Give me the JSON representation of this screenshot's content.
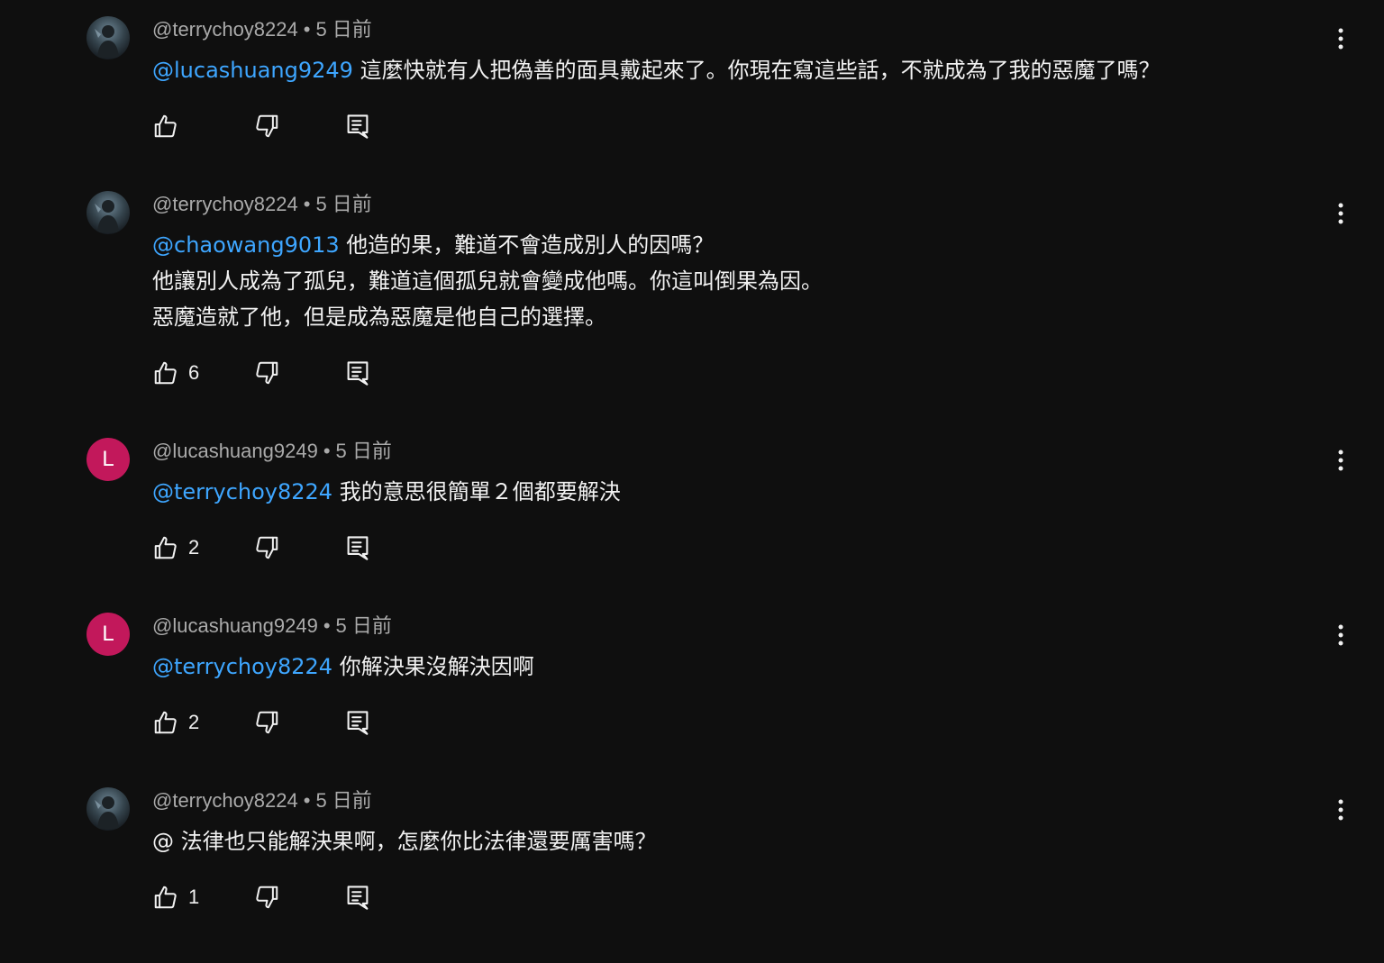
{
  "colors": {
    "background": "#0f0f0f",
    "text": "#f1f1f1",
    "meta_text": "#aaaaaa",
    "mention": "#3ea6ff",
    "letter_avatar": "#c2185b"
  },
  "comments": [
    {
      "author": "@terrychoy8224",
      "separator": "•",
      "time": "5 日前",
      "avatar": {
        "type": "photo",
        "icon": "user-photo-icon"
      },
      "mention": "@lucashuang9249",
      "text_lines": [
        "這麼快就有人把偽善的面具戴起來了。你現在寫這些話，不就成為了我的惡魔了嗎？"
      ],
      "likes": ""
    },
    {
      "author": "@terrychoy8224",
      "separator": "•",
      "time": "5 日前",
      "avatar": {
        "type": "photo",
        "icon": "user-photo-icon"
      },
      "mention": "@chaowang9013",
      "text_lines": [
        "他造的果，難道不會造成別人的因嗎？",
        "他讓別人成為了孤兒，難道這個孤兒就會變成他嗎。你這叫倒果為因。",
        "惡魔造就了他，但是成為惡魔是他自己的選擇。"
      ],
      "likes": "6"
    },
    {
      "author": "@lucashuang9249",
      "separator": "•",
      "time": "5 日前",
      "avatar": {
        "type": "letter",
        "letter": "L"
      },
      "mention": "@terrychoy8224",
      "text_lines": [
        "我的意思很簡單２個都要解決"
      ],
      "likes": "2"
    },
    {
      "author": "@lucashuang9249",
      "separator": "•",
      "time": "5 日前",
      "avatar": {
        "type": "letter",
        "letter": "L"
      },
      "mention": "@terrychoy8224",
      "text_lines": [
        "你解決果沒解決因啊"
      ],
      "likes": "2"
    },
    {
      "author": "@terrychoy8224",
      "separator": "•",
      "time": "5 日前",
      "avatar": {
        "type": "photo",
        "icon": "user-photo-icon"
      },
      "mention": "",
      "text_lines": [
        "@ 法律也只能解決果啊，怎麼你比法律還要厲害嗎？"
      ],
      "likes": "1"
    }
  ]
}
